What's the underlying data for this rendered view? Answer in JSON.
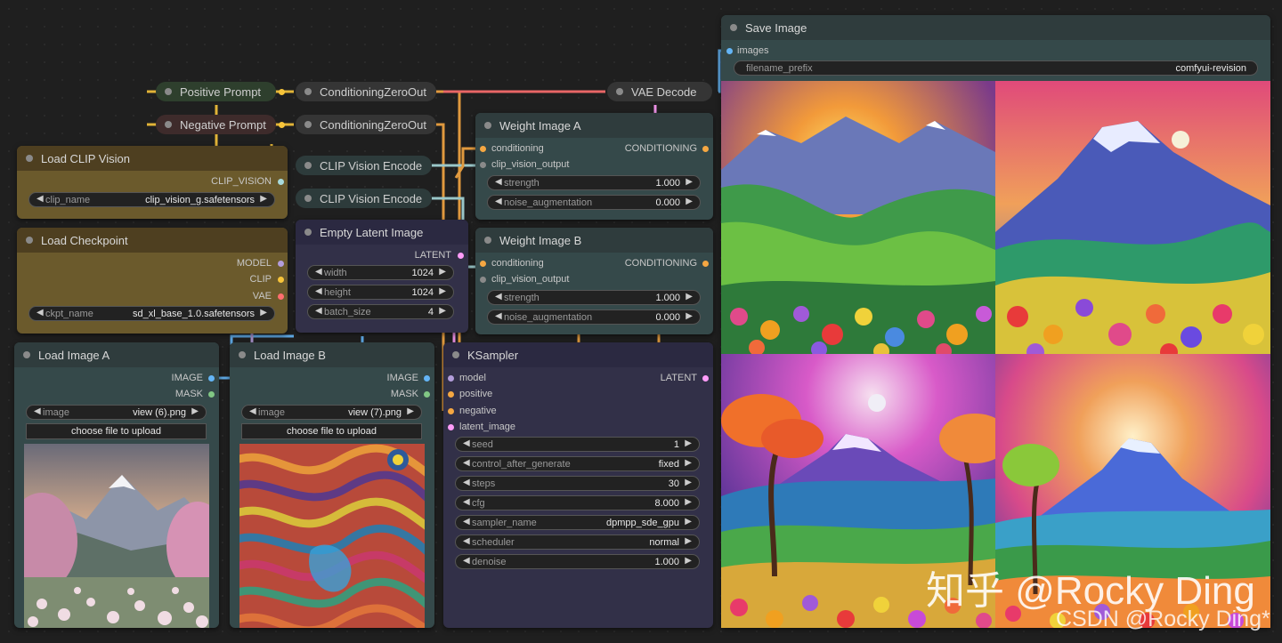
{
  "nodes": {
    "positive_prompt": {
      "title": "Positive Prompt"
    },
    "negative_prompt": {
      "title": "Negative Prompt"
    },
    "cond_zero_1": {
      "title": "ConditioningZeroOut"
    },
    "cond_zero_2": {
      "title": "ConditioningZeroOut"
    },
    "vae_decode": {
      "title": "VAE Decode"
    },
    "clip_vision_encode_1": {
      "title": "CLIP Vision Encode"
    },
    "clip_vision_encode_2": {
      "title": "CLIP Vision Encode"
    },
    "load_clip_vision": {
      "title": "Load CLIP Vision",
      "output": "CLIP_VISION",
      "clip_name_label": "clip_name",
      "clip_name_value": "clip_vision_g.safetensors"
    },
    "load_checkpoint": {
      "title": "Load Checkpoint",
      "out_model": "MODEL",
      "out_clip": "CLIP",
      "out_vae": "VAE",
      "ckpt_label": "ckpt_name",
      "ckpt_value": "sd_xl_base_1.0.safetensors"
    },
    "empty_latent": {
      "title": "Empty Latent Image",
      "output": "LATENT",
      "widgets": [
        {
          "label": "width",
          "value": "1024"
        },
        {
          "label": "height",
          "value": "1024"
        },
        {
          "label": "batch_size",
          "value": "4"
        }
      ]
    },
    "weight_a": {
      "title": "Weight Image A",
      "in_conditioning": "conditioning",
      "in_clip_vision": "clip_vision_output",
      "output": "CONDITIONING",
      "widgets": [
        {
          "label": "strength",
          "value": "1.000"
        },
        {
          "label": "noise_augmentation",
          "value": "0.000"
        }
      ]
    },
    "weight_b": {
      "title": "Weight Image B",
      "in_conditioning": "conditioning",
      "in_clip_vision": "clip_vision_output",
      "output": "CONDITIONING",
      "widgets": [
        {
          "label": "strength",
          "value": "1.000"
        },
        {
          "label": "noise_augmentation",
          "value": "0.000"
        }
      ]
    },
    "load_image_a": {
      "title": "Load Image A",
      "out_image": "IMAGE",
      "out_mask": "MASK",
      "image_label": "image",
      "image_value": "view (6).png",
      "upload": "choose file to upload"
    },
    "load_image_b": {
      "title": "Load Image B",
      "out_image": "IMAGE",
      "out_mask": "MASK",
      "image_label": "image",
      "image_value": "view (7).png",
      "upload": "choose file to upload"
    },
    "ksampler": {
      "title": "KSampler",
      "in_model": "model",
      "in_positive": "positive",
      "in_negative": "negative",
      "in_latent": "latent_image",
      "output": "LATENT",
      "widgets": [
        {
          "label": "seed",
          "value": "1"
        },
        {
          "label": "control_after_generate",
          "value": "fixed"
        },
        {
          "label": "steps",
          "value": "30"
        },
        {
          "label": "cfg",
          "value": "8.000"
        },
        {
          "label": "sampler_name",
          "value": "dpmpp_sde_gpu"
        },
        {
          "label": "scheduler",
          "value": "normal"
        },
        {
          "label": "denoise",
          "value": "1.000"
        }
      ]
    },
    "save_image": {
      "title": "Save Image",
      "in_images": "images",
      "prefix_label": "filename_prefix",
      "prefix_value": "comfyui-revision"
    }
  },
  "watermark": {
    "main": "知乎 @Rocky Ding",
    "sub": "CSDN @Rocky Ding*"
  },
  "colors": {
    "canvas": "#1f1f1f",
    "node_body": "#353535",
    "clip_yellow": "#f7c43a",
    "conditioning_orange": "#f5a742",
    "model_purple": "#b39ddb",
    "latent_pink": "#ff9cf9",
    "vae_red": "#ff6e6e",
    "image_blue": "#64b5f6",
    "mask_green": "#81c784",
    "clip_vision_cyan": "#a8dadc"
  }
}
